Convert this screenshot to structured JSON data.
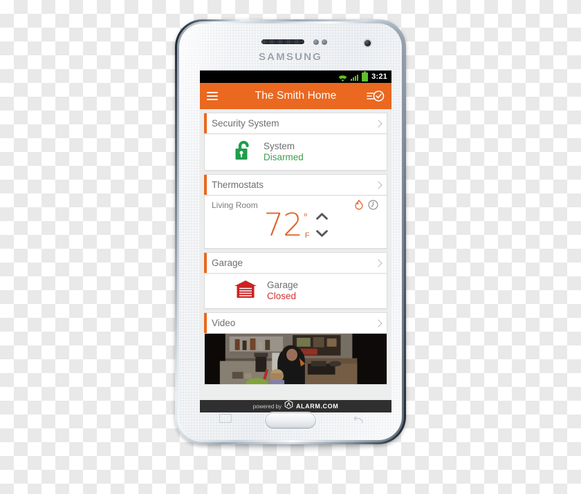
{
  "device": {
    "brand": "SAMSUNG",
    "speaker": "earpiece-speaker",
    "home_button": "home-button",
    "recents_key": "recents-key",
    "back_key": "back-key"
  },
  "status_bar": {
    "wifi_icon": "wifi-icon",
    "signal_icon": "cellular-signal-icon",
    "battery_icon": "battery-icon",
    "time": "3:21"
  },
  "app_bar": {
    "menu_icon": "hamburger-menu-icon",
    "title": "The Smith Home",
    "action_icon": "checklist-check-icon"
  },
  "sections": [
    {
      "id": "security",
      "header": "Security System",
      "chevron": "chevron-right-icon",
      "icon": "unlocked-padlock-icon",
      "icon_color": "#1f9e4b",
      "device_name": "System",
      "state": "Disarmed",
      "state_color": "#3aa04a"
    },
    {
      "id": "thermostats",
      "header": "Thermostats",
      "chevron": "chevron-right-icon",
      "zone": "Living Room",
      "mode_icon": "flame-heat-icon",
      "schedule_icon": "clock-schedule-icon",
      "temperature": "72",
      "degree_symbol": "°",
      "unit": "F",
      "temp_color": "#e2622a",
      "up_icon": "chevron-up-icon",
      "down_icon": "chevron-down-icon"
    },
    {
      "id": "garage",
      "header": "Garage",
      "chevron": "chevron-right-icon",
      "icon": "garage-door-icon",
      "icon_color": "#cc2222",
      "device_name": "Garage",
      "state": "Closed",
      "state_color": "#d33030"
    },
    {
      "id": "video",
      "header": "Video",
      "chevron": "chevron-right-icon",
      "thumbnail": "kitchen-camera-feed"
    }
  ],
  "footer": {
    "powered_by": "powered by",
    "logo_icon": "alarm-dot-com-hexagon-logo",
    "brand": "ALARM.COM"
  },
  "theme": {
    "accent": "#ea6820",
    "green": "#3aa04a",
    "red": "#d33030",
    "text_gray": "#6d6e70"
  }
}
